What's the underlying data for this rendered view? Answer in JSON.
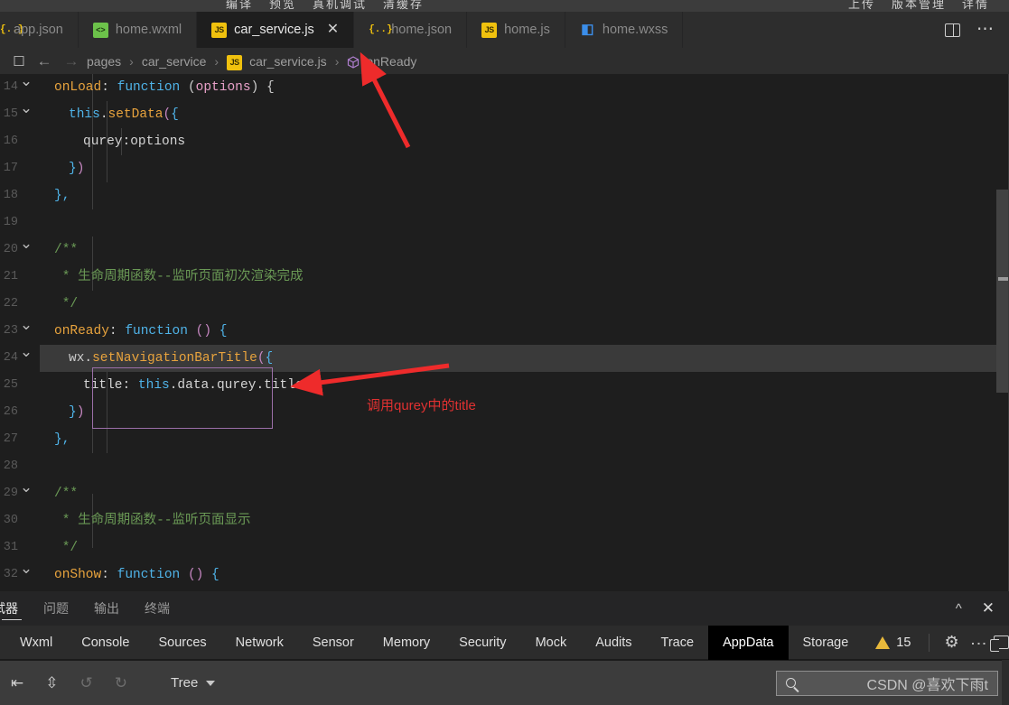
{
  "top_menu": {
    "left_items": [
      "编译",
      "预览",
      "真机调试",
      "清缓存"
    ],
    "right_items": [
      "上传",
      "版本管理",
      "详情"
    ]
  },
  "tabs": [
    {
      "label": "app.json",
      "icon": "json-file-icon",
      "icon_text": "{..}",
      "active": false,
      "closable": false
    },
    {
      "label": "home.wxml",
      "icon": "wxml-file-icon",
      "icon_text": "<>",
      "active": false,
      "closable": false
    },
    {
      "label": "car_service.js",
      "icon": "js-file-icon",
      "icon_text": "JS",
      "active": true,
      "closable": true
    },
    {
      "label": "home.json",
      "icon": "json-file-icon",
      "icon_text": "{..}",
      "active": false,
      "closable": false
    },
    {
      "label": "home.js",
      "icon": "js-file-icon",
      "icon_text": "JS",
      "active": false,
      "closable": false
    },
    {
      "label": "home.wxss",
      "icon": "wxss-file-icon",
      "icon_text": "≡",
      "active": false,
      "closable": false
    }
  ],
  "tab_close_glyph": "✕",
  "tabbar_actions": {
    "split_editor": "split-editor-icon",
    "more": "…"
  },
  "breadcrumb": {
    "bookmark_icon": "🔖",
    "back_icon": "←",
    "forward_icon": "→",
    "separator": "›",
    "items": [
      {
        "label": "pages",
        "icon": null
      },
      {
        "label": "car_service",
        "icon": null
      },
      {
        "label": "car_service.js",
        "icon": "js-file-icon",
        "icon_text": "JS"
      },
      {
        "label": "onReady",
        "icon": "symbol-method-icon"
      }
    ]
  },
  "editor": {
    "first_line_number": 14,
    "lines": [
      {
        "num": "14",
        "fold": true,
        "highlight": false,
        "indent": 0,
        "tokens": [
          {
            "t": "onLoad",
            "c": "orange"
          },
          {
            "t": ": ",
            "c": "white"
          },
          {
            "t": "function",
            "c": "blue"
          },
          {
            "t": " (",
            "c": "grey"
          },
          {
            "t": "options",
            "c": "pink"
          },
          {
            "t": ") {",
            "c": "grey"
          }
        ]
      },
      {
        "num": "15",
        "fold": true,
        "highlight": false,
        "indent": 1,
        "tokens": [
          {
            "t": "this",
            "c": "blue"
          },
          {
            "t": ".",
            "c": "white"
          },
          {
            "t": "setData",
            "c": "orange"
          },
          {
            "t": "(",
            "c": "purple"
          },
          {
            "t": "{",
            "c": "blue"
          }
        ]
      },
      {
        "num": "16",
        "fold": false,
        "highlight": false,
        "indent": 2,
        "tokens": [
          {
            "t": "qurey:options",
            "c": "white"
          }
        ]
      },
      {
        "num": "17",
        "fold": false,
        "highlight": false,
        "indent": 1,
        "tokens": [
          {
            "t": "}",
            "c": "blue"
          },
          {
            "t": ")",
            "c": "purple"
          }
        ]
      },
      {
        "num": "18",
        "fold": false,
        "highlight": false,
        "indent": 0,
        "tokens": [
          {
            "t": "},",
            "c": "blue"
          }
        ]
      },
      {
        "num": "19",
        "fold": false,
        "highlight": false,
        "indent": 0,
        "tokens": []
      },
      {
        "num": "20",
        "fold": true,
        "highlight": false,
        "indent": 0,
        "tokens": [
          {
            "t": "/**",
            "c": "green"
          }
        ]
      },
      {
        "num": "21",
        "fold": false,
        "highlight": false,
        "indent": 0,
        "tokens": [
          {
            "t": " * 生命周期函数--监听页面初次渲染完成",
            "c": "green"
          }
        ]
      },
      {
        "num": "22",
        "fold": false,
        "highlight": false,
        "indent": 0,
        "tokens": [
          {
            "t": " */",
            "c": "green"
          }
        ]
      },
      {
        "num": "23",
        "fold": true,
        "highlight": false,
        "indent": 0,
        "tokens": [
          {
            "t": "onReady",
            "c": "orange"
          },
          {
            "t": ": ",
            "c": "white"
          },
          {
            "t": "function",
            "c": "blue"
          },
          {
            "t": " ",
            "c": "white"
          },
          {
            "t": "()",
            "c": "purple"
          },
          {
            "t": " {",
            "c": "blue"
          }
        ]
      },
      {
        "num": "24",
        "fold": true,
        "highlight": true,
        "indent": 1,
        "tokens": [
          {
            "t": "wx",
            "c": "grey"
          },
          {
            "t": ".",
            "c": "white"
          },
          {
            "t": "setNavigationBarTitle",
            "c": "orange"
          },
          {
            "t": "(",
            "c": "purple"
          },
          {
            "t": "{",
            "c": "blue"
          }
        ]
      },
      {
        "num": "25",
        "fold": false,
        "highlight": false,
        "indent": 2,
        "tokens": [
          {
            "t": "title: ",
            "c": "white"
          },
          {
            "t": "this",
            "c": "blue"
          },
          {
            "t": ".data.qurey.title",
            "c": "white"
          }
        ]
      },
      {
        "num": "26",
        "fold": false,
        "highlight": false,
        "indent": 1,
        "tokens": [
          {
            "t": "}",
            "c": "blue"
          },
          {
            "t": ")",
            "c": "purple"
          }
        ]
      },
      {
        "num": "27",
        "fold": false,
        "highlight": false,
        "indent": 0,
        "tokens": [
          {
            "t": "},",
            "c": "blue"
          }
        ]
      },
      {
        "num": "28",
        "fold": false,
        "highlight": false,
        "indent": 0,
        "tokens": []
      },
      {
        "num": "29",
        "fold": true,
        "highlight": false,
        "indent": 0,
        "tokens": [
          {
            "t": "/**",
            "c": "green"
          }
        ]
      },
      {
        "num": "30",
        "fold": false,
        "highlight": false,
        "indent": 0,
        "tokens": [
          {
            "t": " * 生命周期函数--监听页面显示",
            "c": "green"
          }
        ]
      },
      {
        "num": "31",
        "fold": false,
        "highlight": false,
        "indent": 0,
        "tokens": [
          {
            "t": " */",
            "c": "green"
          }
        ]
      },
      {
        "num": "32",
        "fold": true,
        "highlight": false,
        "indent": 0,
        "tokens": [
          {
            "t": "onShow",
            "c": "orange"
          },
          {
            "t": ": ",
            "c": "white"
          },
          {
            "t": "function",
            "c": "blue"
          },
          {
            "t": " ",
            "c": "white"
          },
          {
            "t": "()",
            "c": "purple"
          },
          {
            "t": " {",
            "c": "blue"
          }
        ]
      }
    ]
  },
  "annotations": {
    "color": "#e03131",
    "callout_text": "调用qurey中的title"
  },
  "panel_tabs": [
    {
      "label": "试器",
      "active": true
    },
    {
      "label": "问题",
      "active": false
    },
    {
      "label": "输出",
      "active": false
    },
    {
      "label": "终端",
      "active": false
    }
  ],
  "panel_actions": {
    "collapse_icon": "⌃",
    "close_icon": "✕"
  },
  "devtools_tabs": [
    {
      "label": "Wxml",
      "active": false
    },
    {
      "label": "Console",
      "active": false
    },
    {
      "label": "Sources",
      "active": false
    },
    {
      "label": "Network",
      "active": false
    },
    {
      "label": "Sensor",
      "active": false
    },
    {
      "label": "Memory",
      "active": false
    },
    {
      "label": "Security",
      "active": false
    },
    {
      "label": "Mock",
      "active": false
    },
    {
      "label": "Audits",
      "active": false
    },
    {
      "label": "Trace",
      "active": false
    },
    {
      "label": "AppData",
      "active": true
    },
    {
      "label": "Storage",
      "active": false
    }
  ],
  "devtools_status": {
    "warning_count": "15",
    "warning_icon": "warning-triangle-icon",
    "settings_icon": "gear-icon",
    "more_icon": "vertical-dots-icon",
    "dock_icon": "dock-side-icon"
  },
  "appdata_toolbar": {
    "collapse_all_icon": "collapse-all-icon",
    "expand_all_icon": "expand-all-icon",
    "undo_icon": "↺",
    "redo_icon": "↻",
    "view_mode": "Tree",
    "search_placeholder": "",
    "search_value": "",
    "search_icon": "search-icon"
  },
  "watermark": "CSDN @喜欢下雨t",
  "colors": {
    "editor_bg": "#1e1e1e",
    "tabbar_bg": "#2d2d2d",
    "active_tab_bg": "#1e1e1e",
    "highlight_line": "#3a3a3a",
    "accent_js": "#f0c10e",
    "accent_wxml": "#6cc24a",
    "accent_wxss": "#3b8eea",
    "annotation_red": "#e03131",
    "warning_yellow": "#e8b93b",
    "appdata_active_bg": "#000000"
  }
}
